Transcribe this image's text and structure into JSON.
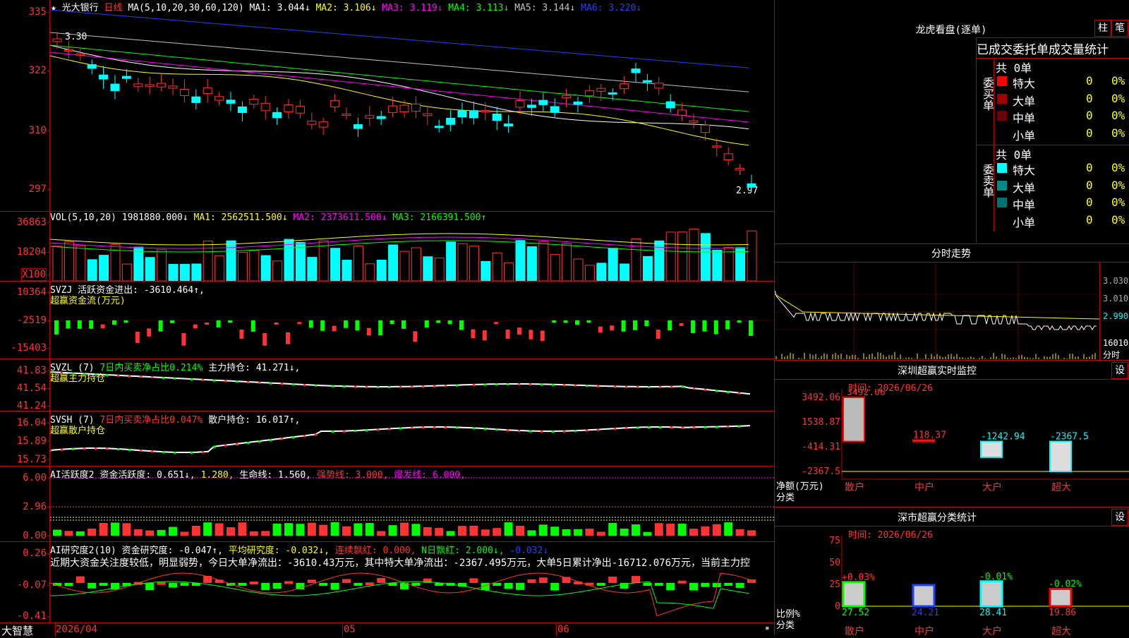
{
  "price_panel": {
    "stock_marker": "★",
    "stock_name": "光大银行",
    "period": "日线",
    "ma_params": "MA(5,10,20,30,60,120)",
    "ma_values": [
      {
        "label": "MA1: 3.044↓",
        "color": "#ffffff"
      },
      {
        "label": "MA2: 3.106↓",
        "color": "#ffff00"
      },
      {
        "label": "MA3: 3.119↓",
        "color": "#ff00ff"
      },
      {
        "label": "MA4: 3.113↓",
        "color": "#00ff00"
      },
      {
        "label": "MA5: 3.144↓",
        "color": "#c0c0c0"
      },
      {
        "label": "MA6: 3.220↓",
        "color": "#2040ff"
      }
    ],
    "y_ticks": [
      "335",
      "322",
      "310",
      "297"
    ],
    "high_label": "3.30",
    "low_label": "2.97"
  },
  "volume_panel": {
    "params": "VOL(5,10,20)",
    "value": "1981880.000↓",
    "ma_values": [
      {
        "label": "MA1: 2562511.500↓",
        "color": "#ffff00"
      },
      {
        "label": "MA2: 2373611.500↓",
        "color": "#ff00ff"
      },
      {
        "label": "MA3: 2166391.500↑",
        "color": "#00ff00"
      }
    ],
    "y_ticks": [
      "36863",
      "18204"
    ],
    "unit": "X100"
  },
  "svzj_panel": {
    "name": "SVZJ",
    "line1": "活跃资金进出: -3610.464↑,",
    "line2": "超赢资金流(万元)",
    "y_ticks": [
      "10364",
      "-2519",
      "-15403"
    ]
  },
  "svzl_panel": {
    "name": "SVZL (7)",
    "desc": "7日内买卖净占比0.214%",
    "value": "主力持仓: 41.271↓,",
    "line2": "超赢主力持仓",
    "y_ticks": [
      "41.83",
      "41.54",
      "41.24"
    ]
  },
  "svsh_panel": {
    "name": "SVSH (7)",
    "desc": "7日内买卖净占比0.047%",
    "value": "散户持仓: 16.017↑,",
    "line2": "超赢散户持仓",
    "y_ticks": [
      "16.04",
      "15.89",
      "15.73"
    ]
  },
  "ai_active_panel": {
    "name": "AI活跃度2",
    "v1": "资金活跃度: 0.651↓,",
    "v2": "1.280,",
    "v3": "生命线: 1.560,",
    "v4": "强势线: 3.000,",
    "v5": "爆发线: 6.000,",
    "y_ticks": [
      "6.00",
      "2.96",
      "0.00"
    ]
  },
  "ai_research_panel": {
    "name": "AI研究度2(10)",
    "v1": "资金研究度: -0.047↑,",
    "v2": "平均研究度: -0.032↓,",
    "v3": "连续飘红: 0.000,",
    "v4": "N日飘红: 2.000↓,",
    "v5": "-0.032↓",
    "comment": "近期大资金关注度较低，明显弱势，今日大单净流出：-3610.43万元，其中特大单净流出：-2367.495万元，大单5日累计净出-16712.076万元，当前主力控",
    "y_ticks": [
      "0.26",
      "-0.07",
      "-0.41"
    ]
  },
  "bottom_bar": {
    "app_name": "大智慧",
    "date_start": "2026/04",
    "month_05": "05",
    "month_06": "06"
  },
  "dragon_tiger": {
    "title": "龙虎看盘(逐单)",
    "btn_column": "柱",
    "btn_pen": "笔",
    "header": "已成交委托单成交量统计",
    "buy_label": "委买单",
    "sell_label": "委卖单",
    "buy_total": "共 0单",
    "sell_total": "共 0单",
    "buy_rows": [
      {
        "name": "特大",
        "value": "0",
        "pct": "0%",
        "color": "#ff0000"
      },
      {
        "name": "大单",
        "value": "0",
        "pct": "0%",
        "color": "#a00000"
      },
      {
        "name": "中单",
        "value": "0",
        "pct": "0%",
        "color": "#700000"
      },
      {
        "name": "小单",
        "value": "0",
        "pct": "0%",
        "color": "#000000"
      }
    ],
    "sell_rows": [
      {
        "name": "特大",
        "value": "0",
        "pct": "0%",
        "color": "#00ffff"
      },
      {
        "name": "大单",
        "value": "0",
        "pct": "0%",
        "color": "#008b8b"
      },
      {
        "name": "中单",
        "value": "0",
        "pct": "0%",
        "color": "#007070"
      },
      {
        "name": "小单",
        "value": "0",
        "pct": "0%",
        "color": "#000000"
      }
    ]
  },
  "intraday": {
    "title": "分时走势",
    "y_ticks": [
      "3.030",
      "3.010",
      "2.990"
    ],
    "vol_tick": "16010",
    "x_label": "分时"
  },
  "sz_monitor": {
    "title": "深圳超赢实时监控",
    "btn": "设",
    "time": "时间: 2026/06/26",
    "y_ticks": [
      "3492.06",
      "1538.87",
      "-414.31",
      "-2367.5"
    ],
    "y_axis_label": "净额(万元)",
    "x_axis_label": "分类",
    "categories": [
      "散户",
      "中户",
      "大户",
      "超大"
    ],
    "bar_values": [
      "3492.06",
      "118.37",
      "-1242.94",
      "-2367.5"
    ]
  },
  "sz_classify": {
    "title": "深市超赢分类统计",
    "btn": "设",
    "time": "时间: 2026/06/26",
    "y_ticks": [
      "75",
      "50",
      "25",
      "0"
    ],
    "y_axis_label": "比例%",
    "x_axis_label": "分类",
    "categories": [
      "散户",
      "中户",
      "大户",
      "超大"
    ],
    "change_labels": [
      "+0.03%",
      "",
      "-0.01%",
      "-0.02%"
    ],
    "values": [
      "27.52",
      "24.21",
      "28.41",
      "19.86"
    ]
  },
  "chart_data": [
    {
      "type": "bar",
      "title": "深圳超赢实时监控",
      "ylabel": "净额(万元)",
      "xlabel": "分类",
      "categories": [
        "散户",
        "中户",
        "大户",
        "超大"
      ],
      "values": [
        3492.06,
        118.37,
        -1242.94,
        -2367.5
      ],
      "ylim": [
        -2367.5,
        3492.06
      ]
    },
    {
      "type": "bar",
      "title": "深市超赢分类统计",
      "ylabel": "比例%",
      "xlabel": "分类",
      "categories": [
        "散户",
        "中户",
        "大户",
        "超大"
      ],
      "values": [
        27.52,
        24.21,
        28.41,
        19.86
      ],
      "ylim": [
        0,
        75
      ]
    }
  ]
}
